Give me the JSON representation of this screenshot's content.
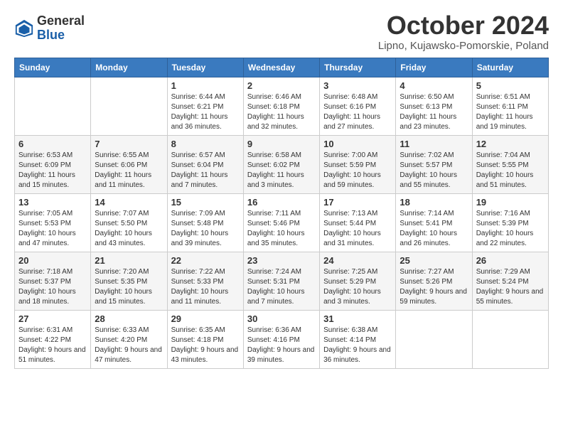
{
  "logo": {
    "general": "General",
    "blue": "Blue"
  },
  "header": {
    "month": "October 2024",
    "location": "Lipno, Kujawsko-Pomorskie, Poland"
  },
  "days_of_week": [
    "Sunday",
    "Monday",
    "Tuesday",
    "Wednesday",
    "Thursday",
    "Friday",
    "Saturday"
  ],
  "weeks": [
    [
      {
        "day": "",
        "info": ""
      },
      {
        "day": "",
        "info": ""
      },
      {
        "day": "1",
        "info": "Sunrise: 6:44 AM\nSunset: 6:21 PM\nDaylight: 11 hours and 36 minutes."
      },
      {
        "day": "2",
        "info": "Sunrise: 6:46 AM\nSunset: 6:18 PM\nDaylight: 11 hours and 32 minutes."
      },
      {
        "day": "3",
        "info": "Sunrise: 6:48 AM\nSunset: 6:16 PM\nDaylight: 11 hours and 27 minutes."
      },
      {
        "day": "4",
        "info": "Sunrise: 6:50 AM\nSunset: 6:13 PM\nDaylight: 11 hours and 23 minutes."
      },
      {
        "day": "5",
        "info": "Sunrise: 6:51 AM\nSunset: 6:11 PM\nDaylight: 11 hours and 19 minutes."
      }
    ],
    [
      {
        "day": "6",
        "info": "Sunrise: 6:53 AM\nSunset: 6:09 PM\nDaylight: 11 hours and 15 minutes."
      },
      {
        "day": "7",
        "info": "Sunrise: 6:55 AM\nSunset: 6:06 PM\nDaylight: 11 hours and 11 minutes."
      },
      {
        "day": "8",
        "info": "Sunrise: 6:57 AM\nSunset: 6:04 PM\nDaylight: 11 hours and 7 minutes."
      },
      {
        "day": "9",
        "info": "Sunrise: 6:58 AM\nSunset: 6:02 PM\nDaylight: 11 hours and 3 minutes."
      },
      {
        "day": "10",
        "info": "Sunrise: 7:00 AM\nSunset: 5:59 PM\nDaylight: 10 hours and 59 minutes."
      },
      {
        "day": "11",
        "info": "Sunrise: 7:02 AM\nSunset: 5:57 PM\nDaylight: 10 hours and 55 minutes."
      },
      {
        "day": "12",
        "info": "Sunrise: 7:04 AM\nSunset: 5:55 PM\nDaylight: 10 hours and 51 minutes."
      }
    ],
    [
      {
        "day": "13",
        "info": "Sunrise: 7:05 AM\nSunset: 5:53 PM\nDaylight: 10 hours and 47 minutes."
      },
      {
        "day": "14",
        "info": "Sunrise: 7:07 AM\nSunset: 5:50 PM\nDaylight: 10 hours and 43 minutes."
      },
      {
        "day": "15",
        "info": "Sunrise: 7:09 AM\nSunset: 5:48 PM\nDaylight: 10 hours and 39 minutes."
      },
      {
        "day": "16",
        "info": "Sunrise: 7:11 AM\nSunset: 5:46 PM\nDaylight: 10 hours and 35 minutes."
      },
      {
        "day": "17",
        "info": "Sunrise: 7:13 AM\nSunset: 5:44 PM\nDaylight: 10 hours and 31 minutes."
      },
      {
        "day": "18",
        "info": "Sunrise: 7:14 AM\nSunset: 5:41 PM\nDaylight: 10 hours and 26 minutes."
      },
      {
        "day": "19",
        "info": "Sunrise: 7:16 AM\nSunset: 5:39 PM\nDaylight: 10 hours and 22 minutes."
      }
    ],
    [
      {
        "day": "20",
        "info": "Sunrise: 7:18 AM\nSunset: 5:37 PM\nDaylight: 10 hours and 18 minutes."
      },
      {
        "day": "21",
        "info": "Sunrise: 7:20 AM\nSunset: 5:35 PM\nDaylight: 10 hours and 15 minutes."
      },
      {
        "day": "22",
        "info": "Sunrise: 7:22 AM\nSunset: 5:33 PM\nDaylight: 10 hours and 11 minutes."
      },
      {
        "day": "23",
        "info": "Sunrise: 7:24 AM\nSunset: 5:31 PM\nDaylight: 10 hours and 7 minutes."
      },
      {
        "day": "24",
        "info": "Sunrise: 7:25 AM\nSunset: 5:29 PM\nDaylight: 10 hours and 3 minutes."
      },
      {
        "day": "25",
        "info": "Sunrise: 7:27 AM\nSunset: 5:26 PM\nDaylight: 9 hours and 59 minutes."
      },
      {
        "day": "26",
        "info": "Sunrise: 7:29 AM\nSunset: 5:24 PM\nDaylight: 9 hours and 55 minutes."
      }
    ],
    [
      {
        "day": "27",
        "info": "Sunrise: 6:31 AM\nSunset: 4:22 PM\nDaylight: 9 hours and 51 minutes."
      },
      {
        "day": "28",
        "info": "Sunrise: 6:33 AM\nSunset: 4:20 PM\nDaylight: 9 hours and 47 minutes."
      },
      {
        "day": "29",
        "info": "Sunrise: 6:35 AM\nSunset: 4:18 PM\nDaylight: 9 hours and 43 minutes."
      },
      {
        "day": "30",
        "info": "Sunrise: 6:36 AM\nSunset: 4:16 PM\nDaylight: 9 hours and 39 minutes."
      },
      {
        "day": "31",
        "info": "Sunrise: 6:38 AM\nSunset: 4:14 PM\nDaylight: 9 hours and 36 minutes."
      },
      {
        "day": "",
        "info": ""
      },
      {
        "day": "",
        "info": ""
      }
    ]
  ]
}
